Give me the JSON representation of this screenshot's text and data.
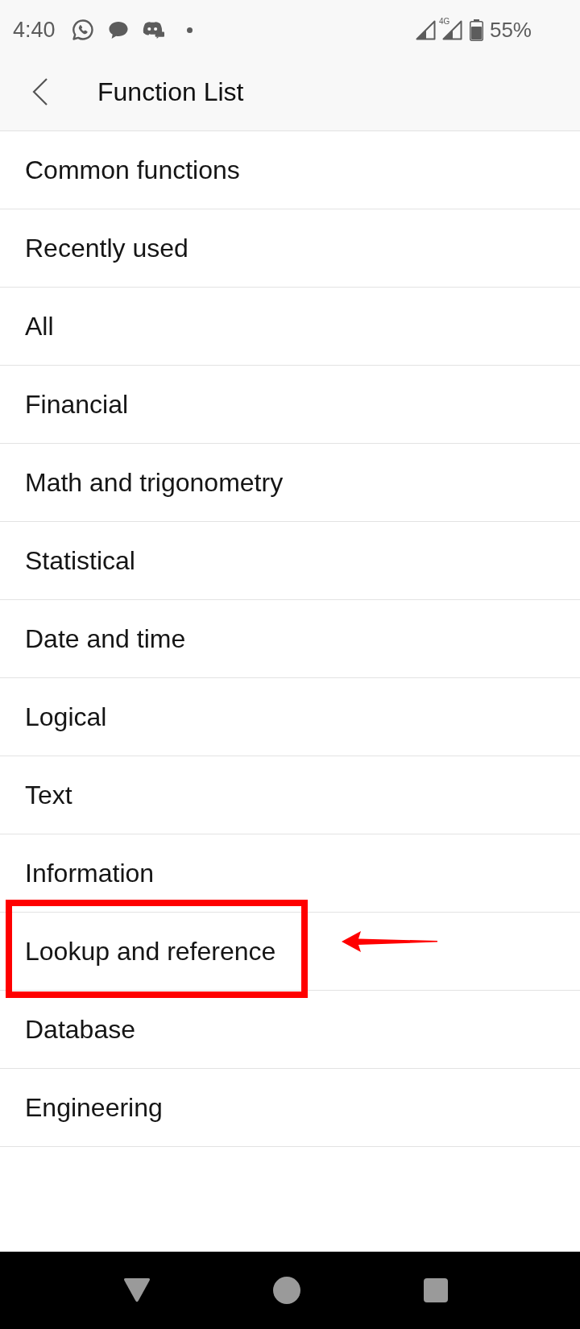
{
  "status_bar": {
    "time": "4:40",
    "network": "4G",
    "battery": "55%"
  },
  "header": {
    "title": "Function List"
  },
  "items": [
    {
      "label": "Common functions",
      "highlighted": false
    },
    {
      "label": "Recently used",
      "highlighted": false
    },
    {
      "label": "All",
      "highlighted": false
    },
    {
      "label": "Financial",
      "highlighted": false
    },
    {
      "label": "Math and trigonometry",
      "highlighted": false
    },
    {
      "label": "Statistical",
      "highlighted": false
    },
    {
      "label": "Date and time",
      "highlighted": false
    },
    {
      "label": "Logical",
      "highlighted": false
    },
    {
      "label": "Text",
      "highlighted": false
    },
    {
      "label": "Information",
      "highlighted": false
    },
    {
      "label": "Lookup and reference",
      "highlighted": true
    },
    {
      "label": "Database",
      "highlighted": false
    },
    {
      "label": "Engineering",
      "highlighted": false
    }
  ]
}
